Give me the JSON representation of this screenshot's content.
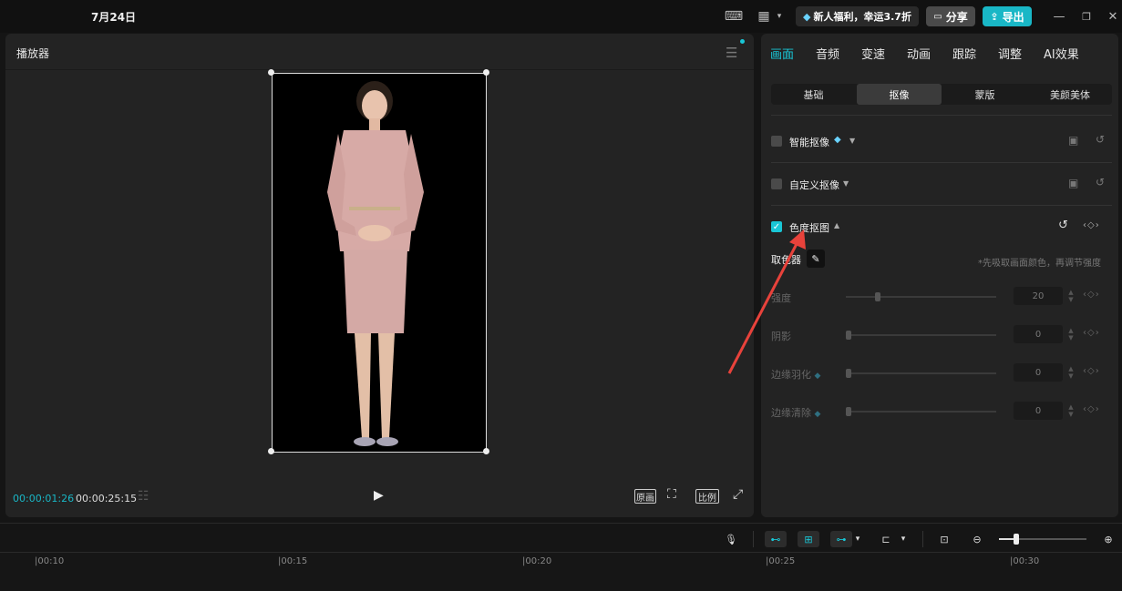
{
  "titlebar": {
    "title": "7月24日",
    "promo": "新人福利，幸运3.7折",
    "share": "分享",
    "export": "导出"
  },
  "player": {
    "title": "播放器",
    "current_time": "00:00:01:26",
    "total_time": "00:00:25:15",
    "btn_original": "原画",
    "btn_ratio": "比例"
  },
  "panel": {
    "tabs": [
      "画面",
      "音频",
      "变速",
      "动画",
      "跟踪",
      "调整",
      "AI效果"
    ],
    "active_tab": 0,
    "subtabs": [
      "基础",
      "抠像",
      "蒙版",
      "美颜美体"
    ],
    "active_subtab": 1,
    "smart_cutout": {
      "label": "智能抠像",
      "checked": false
    },
    "custom_cutout": {
      "label": "自定义抠像",
      "checked": false
    },
    "chroma_key": {
      "label": "色度抠图",
      "checked": true
    },
    "color_picker_label": "取色器",
    "hint": "*先吸取画面颜色，再调节强度",
    "sliders": [
      {
        "label": "强度",
        "value": "20",
        "fraction": 0.2
      },
      {
        "label": "阴影",
        "value": "0",
        "fraction": 0
      },
      {
        "label": "边缘羽化",
        "value": "0",
        "fraction": 0
      },
      {
        "label": "边缘清除",
        "value": "0",
        "fraction": 0
      }
    ]
  },
  "timeline": {
    "ticks": [
      "|00:10",
      "|00:15",
      "|00:20",
      "|00:25",
      "|00:30"
    ]
  },
  "colors": {
    "accent": "#19c6d6",
    "annotation_arrow": "#e8423b"
  }
}
